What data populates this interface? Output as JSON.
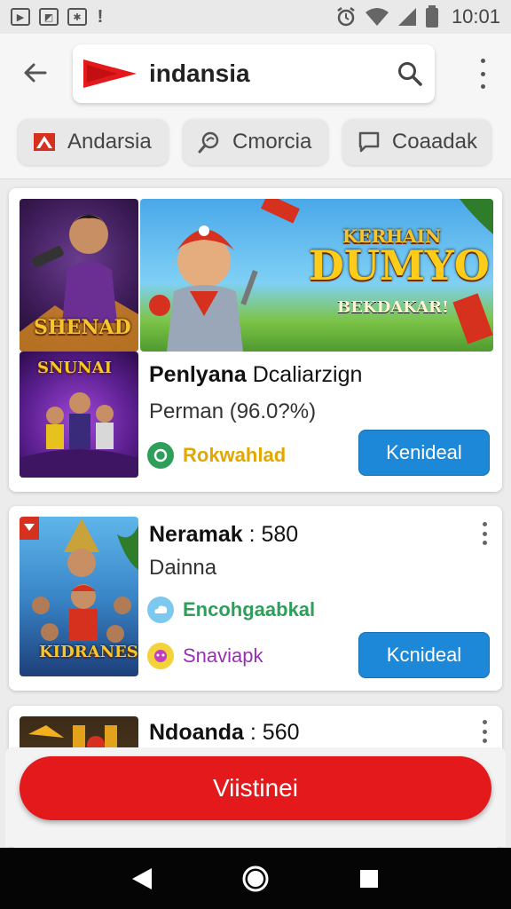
{
  "status_bar": {
    "time": "10:01",
    "left_icons": [
      "play-icon",
      "image-icon",
      "usb-icon",
      "alert-icon"
    ],
    "right_icons": [
      "alarm-icon",
      "wifi-icon",
      "signal-icon",
      "battery-icon"
    ]
  },
  "header": {
    "search_text": "indansia",
    "chips": [
      {
        "label": "Andarsia",
        "icon": "flag-icon"
      },
      {
        "label": "Cmorcia",
        "icon": "search-icon"
      },
      {
        "label": "Coaadak",
        "icon": "chat-icon"
      }
    ]
  },
  "cards": [
    {
      "thumb_small_top_text": "SHENAD",
      "thumb_small_bottom_text": "SNUNAI",
      "banner_top_text": "KERHAIN",
      "banner_main_text": "DUMYO",
      "banner_sub_text": "BEKDAKAR!",
      "title": "Penlyana",
      "title_rest": "Dcaliarzign",
      "subtitle": "Perman (96.0?%)",
      "meta_label": "Rokwahlad",
      "button_label": "Kenideal"
    },
    {
      "thumb_text": "KIDRANES",
      "title": "Neramak",
      "title_rest": ": 580",
      "subtitle": "Dainna",
      "meta1_label": "Encohgaabkal",
      "meta2_label": "Snaviapk",
      "button_label": "Kcnideal"
    },
    {
      "title": "Ndoanda",
      "title_rest": ": 560"
    }
  ],
  "bottom_button_label": "Viistinei",
  "colors": {
    "accent_red": "#e3191b",
    "button_blue": "#1e88d8",
    "meta_green": "#2e9e5b",
    "meta_yellow": "#e0a800",
    "meta_purple": "#9a2fb5"
  }
}
